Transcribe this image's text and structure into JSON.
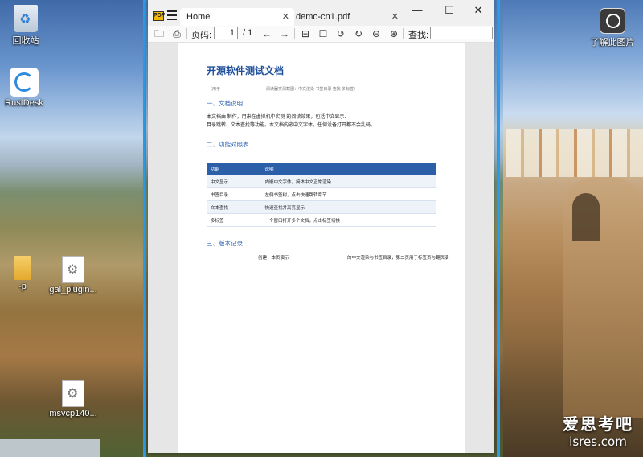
{
  "desktop": {
    "icons": [
      {
        "name": "recycle-bin",
        "label": "回收站"
      },
      {
        "name": "rustdesk",
        "label": "RustDesk"
      },
      {
        "name": "folder",
        "label": "-p"
      },
      {
        "name": "file-gal",
        "label": "gal_plugin..."
      },
      {
        "name": "file-msvcp",
        "label": "msvcp140..."
      },
      {
        "name": "learn-more",
        "label": "了解此图片"
      }
    ],
    "watermark": {
      "line1": "爱思考吧",
      "line2": "isres.com"
    }
  },
  "window": {
    "tabs": [
      {
        "label": "Home",
        "active": true
      },
      {
        "label": "demo-cn1.pdf",
        "active": false
      }
    ],
    "controls": {
      "minimize": "—",
      "maximize": "☐",
      "close": "✕"
    }
  },
  "toolbar": {
    "page_label": "页码:",
    "page_value": "1",
    "page_total": "/ 1",
    "search_label": "查找:",
    "search_value": ""
  },
  "document": {
    "title": "开源软件测试文档",
    "meta_left": "（用于",
    "meta_right": "阅读器实测截图：中文渲染    书签目录    查找    多标签）",
    "section1": "一、文档说明",
    "para1_line1": "本文档由                     制作，用来在虚拟机中实测                                  的阅读效果，包括中文显示、",
    "para1_line2": "目录跳转、文本查找等功能。本文档内嵌中文字体，任何设备打开都不会乱码。",
    "section2": "二、功能对照表",
    "table": {
      "headers": [
        "功能",
        "说明"
      ],
      "rows": [
        [
          "中文显示",
          "内嵌中文字体，简体中文正常渲染"
        ],
        [
          "书签目录",
          "左侧书签树，点击快速跳转章节"
        ],
        [
          "文本查找",
          "                快速查找并高亮显示"
        ],
        [
          "多标签",
          "一个窗口打开多个文档，点击标签切换"
        ]
      ]
    },
    "section3": "三、版本记录",
    "version_left": "创建：本页演示",
    "version_right": "的中文渲染与书签目录，第二页用于标签页与翻页演"
  }
}
